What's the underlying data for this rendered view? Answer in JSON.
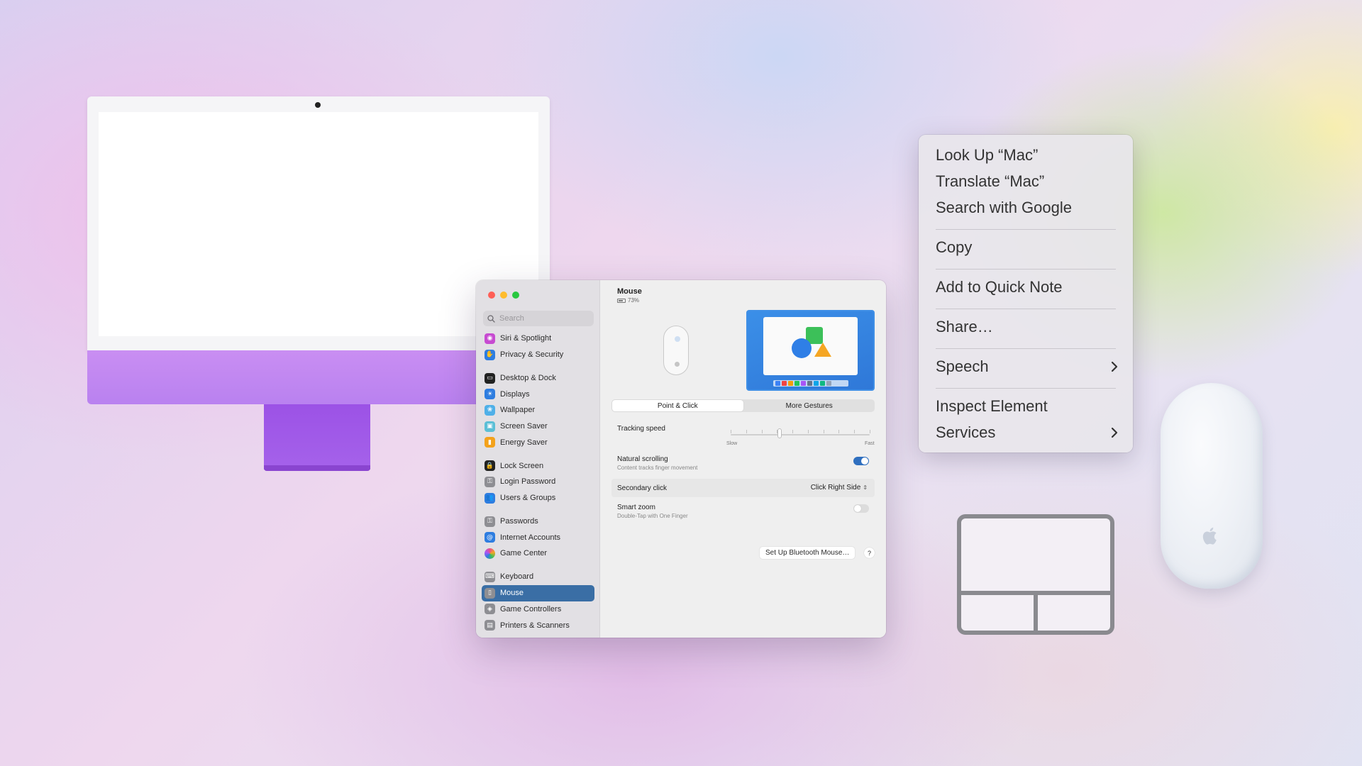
{
  "settings": {
    "search_placeholder": "Search",
    "sidebar": {
      "items": [
        {
          "label": "Siri & Spotlight",
          "icon": "siri-icon",
          "color": "#c74bd1"
        },
        {
          "label": "Privacy & Security",
          "icon": "hand-icon",
          "color": "#2e7de0"
        },
        {
          "label": "Desktop & Dock",
          "icon": "dock-icon",
          "color": "#222222"
        },
        {
          "label": "Displays",
          "icon": "sun-icon",
          "color": "#2e7de0"
        },
        {
          "label": "Wallpaper",
          "icon": "wallpaper-icon",
          "color": "#4fb0e8"
        },
        {
          "label": "Screen Saver",
          "icon": "screensaver-icon",
          "color": "#5bbfd6"
        },
        {
          "label": "Energy Saver",
          "icon": "battery-icon",
          "color": "#f3a21c"
        },
        {
          "label": "Lock Screen",
          "icon": "lock-icon",
          "color": "#222222"
        },
        {
          "label": "Login Password",
          "icon": "key-icon",
          "color": "#8e8e93"
        },
        {
          "label": "Users & Groups",
          "icon": "users-icon",
          "color": "#2e7de0"
        },
        {
          "label": "Passwords",
          "icon": "passwords-icon",
          "color": "#8e8e93"
        },
        {
          "label": "Internet Accounts",
          "icon": "at-icon",
          "color": "#2e7de0"
        },
        {
          "label": "Game Center",
          "icon": "gamecenter-icon",
          "color": "#e94f8a"
        },
        {
          "label": "Keyboard",
          "icon": "keyboard-icon",
          "color": "#8e8e93"
        },
        {
          "label": "Mouse",
          "icon": "mouse-icon",
          "color": "#8e8e93"
        },
        {
          "label": "Game Controllers",
          "icon": "gamecontroller-icon",
          "color": "#8e8e93"
        },
        {
          "label": "Printers & Scanners",
          "icon": "printer-icon",
          "color": "#8e8e93"
        }
      ],
      "selected": "Mouse"
    },
    "main": {
      "title": "Mouse",
      "battery": "73%",
      "battery_level": 0.73,
      "tabs": [
        "Point & Click",
        "More Gestures"
      ],
      "active_tab": "Point & Click",
      "tracking_speed": {
        "label": "Tracking speed",
        "min_label": "Slow",
        "max_label": "Fast",
        "value": 0.35
      },
      "natural_scrolling": {
        "label": "Natural scrolling",
        "sub": "Content tracks finger movement",
        "on": true
      },
      "secondary_click": {
        "label": "Secondary click",
        "value": "Click Right Side"
      },
      "smart_zoom": {
        "label": "Smart zoom",
        "sub": "Double-Tap with One Finger",
        "on": false
      },
      "setup_button": "Set Up Bluetooth Mouse…",
      "help": "?"
    }
  },
  "context_menu": {
    "items": [
      {
        "label": "Look Up “Mac”",
        "submenu": false
      },
      {
        "label": "Translate “Mac”",
        "submenu": false
      },
      {
        "label": "Search with Google",
        "submenu": false
      },
      {
        "label": "Copy",
        "submenu": false
      },
      {
        "label": "Add to Quick Note",
        "submenu": false
      },
      {
        "label": "Share…",
        "submenu": false
      },
      {
        "label": "Speech",
        "submenu": true
      },
      {
        "label": "Inspect Element",
        "submenu": false
      },
      {
        "label": "Services",
        "submenu": true
      }
    ]
  },
  "colors": {
    "imac_purple": "#b981f0",
    "accent_blue": "#3a6ea5"
  }
}
